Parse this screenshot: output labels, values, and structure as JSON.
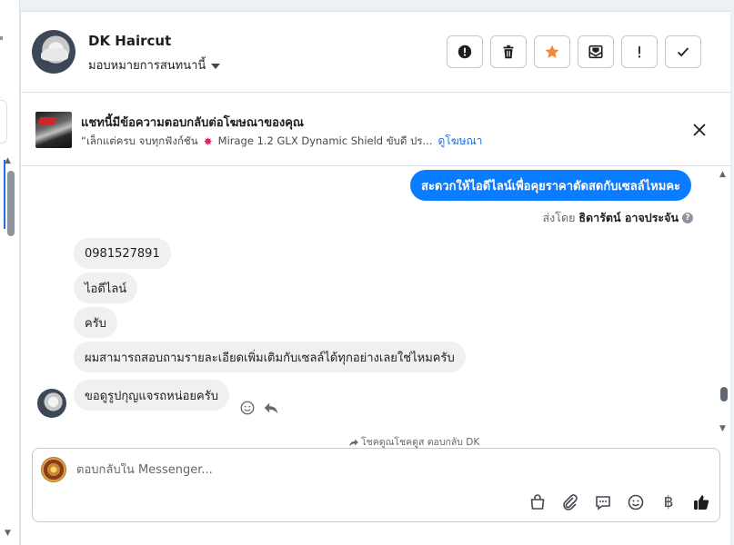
{
  "header": {
    "contact_name": "DK Haircut",
    "assign_label": "มอบหมายการสนทนานี้",
    "actions": [
      {
        "name": "spam-report-button",
        "icon": "alert-circle-icon"
      },
      {
        "name": "delete-button",
        "icon": "trash-icon"
      },
      {
        "name": "star-button",
        "icon": "star-icon",
        "color": "#f5893b"
      },
      {
        "name": "mark-unread-button",
        "icon": "envelope-icon"
      },
      {
        "name": "follow-up-button",
        "icon": "exclamation-icon"
      },
      {
        "name": "mark-done-button",
        "icon": "check-icon"
      }
    ]
  },
  "ad_banner": {
    "title": "แชทนี้มีข้อความตอบกลับต่อโฆษณาของคุณ",
    "snippet_start": "“เล็กแต่ครบ จบทุกฟังก์ชัน",
    "snippet_end": "Mirage 1.2 GLX Dynamic Shield ขับดี ปร...",
    "link_label": "ดูโฆษณา"
  },
  "conversation": {
    "outgoing": {
      "text": "สะดวกให้ไอดีไลน์เพื่อคุยราคาตัดสดกับเซลล์ไหมคะ",
      "sent_by_prefix": "ส่งโดย",
      "sent_by_name": "ธิดารัตน์ อาจประจัน"
    },
    "incoming": [
      "0981527891",
      "ไอดีไลน์",
      "ครับ",
      "ผมสามารถสอบถามรายละเอียดเพิ่มเติมกับเซลล์ได้ทุกอย่างเลยใช่ไหมครับ",
      "ขอดูรูปกุญแจรถหน่อยครับ"
    ],
    "reply_note": "โชคดูณโชคดูส ตอบกลับ DK"
  },
  "composer": {
    "placeholder": "ตอบกลับใน Messenger...",
    "tools": [
      "shopping-bag-icon",
      "paperclip-icon",
      "saved-reply-icon",
      "emoji-icon",
      "baht-icon",
      "like-icon"
    ],
    "baht_symbol": "฿"
  },
  "colors": {
    "accent": "#0a7cff",
    "star": "#f5893b",
    "link": "#216fdb"
  }
}
